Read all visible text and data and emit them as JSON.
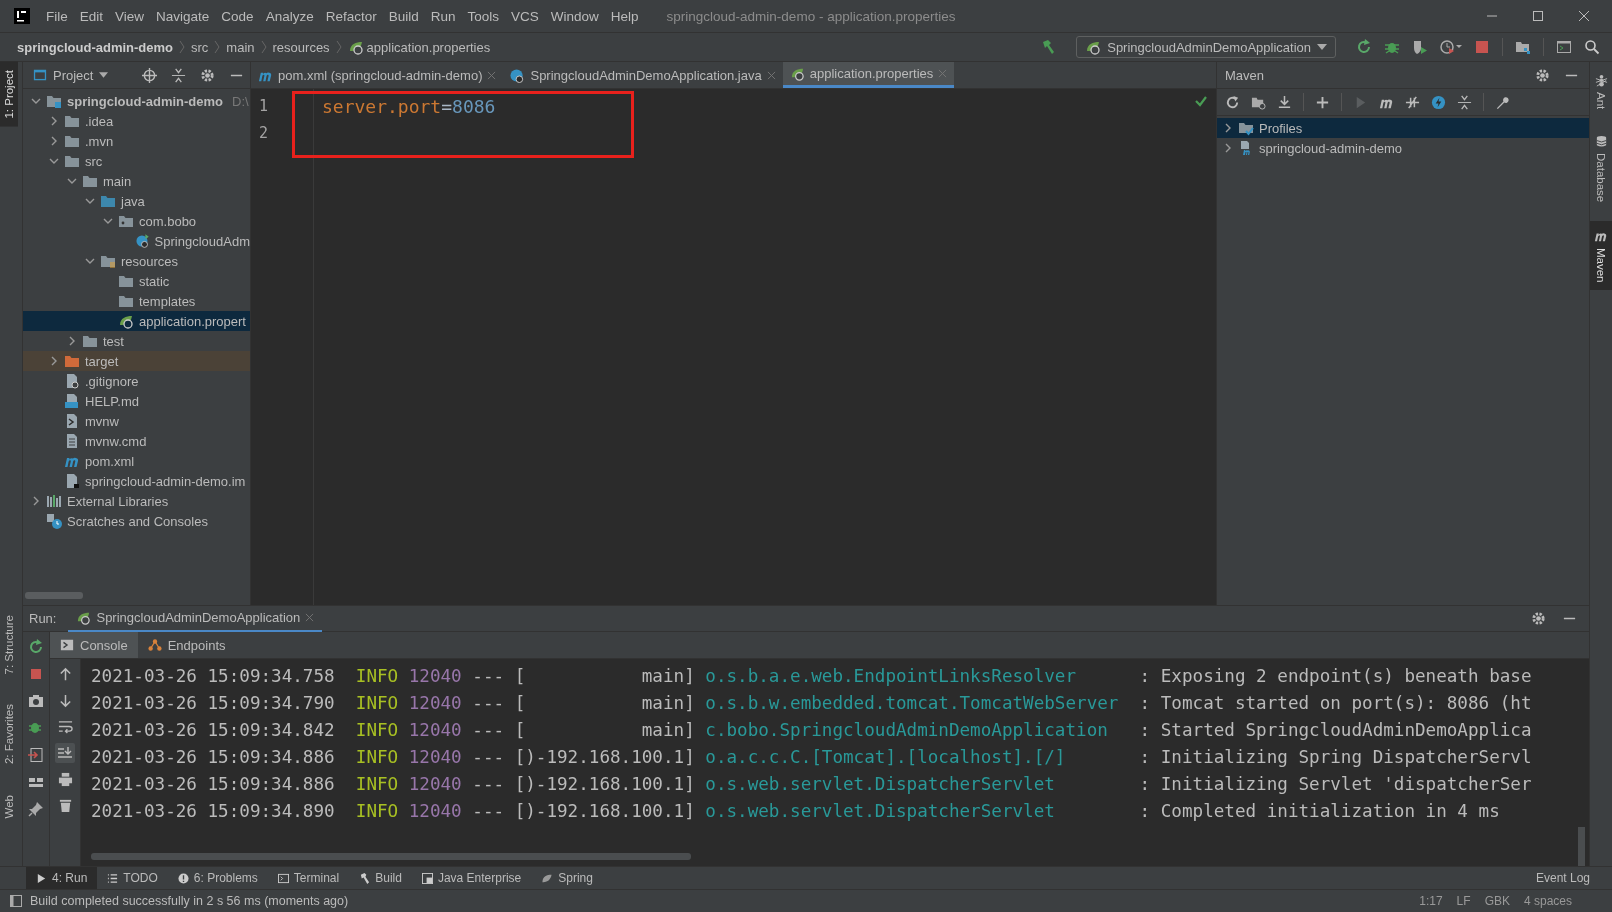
{
  "title_bar": {
    "menu": [
      "File",
      "Edit",
      "View",
      "Navigate",
      "Code",
      "Analyze",
      "Refactor",
      "Build",
      "Run",
      "Tools",
      "VCS",
      "Window",
      "Help"
    ],
    "title": "springcloud-admin-demo - application.properties"
  },
  "navigation_bar": {
    "breadcrumbs": [
      {
        "label": "springcloud-admin-demo",
        "kind": "project"
      },
      {
        "label": "src",
        "kind": "folder"
      },
      {
        "label": "main",
        "kind": "folder"
      },
      {
        "label": "resources",
        "kind": "folder"
      },
      {
        "label": "application.properties",
        "kind": "properties"
      }
    ],
    "run_configuration": "SpringcloudAdminDemoApplication"
  },
  "left_stripe": {
    "top": [
      {
        "label": "1: Project",
        "selected": true
      }
    ],
    "bottom": [
      {
        "label": "7: Structure",
        "selected": false
      },
      {
        "label": "2: Favorites",
        "selected": false
      },
      {
        "label": "Web",
        "selected": false
      }
    ]
  },
  "project": {
    "title": "Project",
    "tree": [
      {
        "label": "springcloud-admin-demo",
        "path": "D:\\",
        "kind": "module",
        "expanded": true,
        "selected": false,
        "children": [
          {
            "label": ".idea",
            "kind": "folder",
            "expanded": false,
            "selected": false
          },
          {
            "label": ".mvn",
            "kind": "folder",
            "expanded": false,
            "selected": false
          },
          {
            "label": "src",
            "kind": "folder",
            "expanded": true,
            "selected": false,
            "children": [
              {
                "label": "main",
                "kind": "folder",
                "expanded": true,
                "selected": false,
                "children": [
                  {
                    "label": "java",
                    "kind": "source-folder",
                    "expanded": true,
                    "selected": false,
                    "children": [
                      {
                        "label": "com.bobo",
                        "kind": "package",
                        "expanded": true,
                        "selected": false,
                        "children": [
                          {
                            "label": "SpringcloudAdm",
                            "kind": "spring-class",
                            "selected": false
                          }
                        ]
                      }
                    ]
                  },
                  {
                    "label": "resources",
                    "kind": "resources-folder",
                    "expanded": true,
                    "selected": false,
                    "children": [
                      {
                        "label": "static",
                        "kind": "folder",
                        "selected": false
                      },
                      {
                        "label": "templates",
                        "kind": "folder",
                        "selected": false
                      },
                      {
                        "label": "application.propert",
                        "kind": "properties",
                        "selected": true
                      }
                    ]
                  }
                ]
              },
              {
                "label": "test",
                "kind": "folder",
                "expanded": false,
                "selected": false
              }
            ]
          },
          {
            "label": "target",
            "kind": "excluded-folder",
            "expanded": false,
            "selected": false
          },
          {
            "label": ".gitignore",
            "kind": "ignore-file",
            "selected": false
          },
          {
            "label": "HELP.md",
            "kind": "markdown",
            "selected": false
          },
          {
            "label": "mvnw",
            "kind": "shell",
            "selected": false
          },
          {
            "label": "mvnw.cmd",
            "kind": "text",
            "selected": false
          },
          {
            "label": "pom.xml",
            "kind": "maven",
            "selected": false
          },
          {
            "label": "springcloud-admin-demo.im",
            "kind": "iml",
            "selected": false
          }
        ]
      },
      {
        "label": "External Libraries",
        "kind": "libraries",
        "expanded": false,
        "selected": false
      },
      {
        "label": "Scratches and Consoles",
        "kind": "scratches",
        "selected": false
      }
    ]
  },
  "editor": {
    "tabs": [
      {
        "label": "pom.xml (springcloud-admin-demo)",
        "kind": "maven",
        "selected": false
      },
      {
        "label": "SpringcloudAdminDemoApplication.java",
        "kind": "spring-class",
        "selected": false
      },
      {
        "label": "application.properties",
        "kind": "properties",
        "selected": true
      }
    ],
    "lines": [
      {
        "number": "1",
        "key": "server.port",
        "operator": "=",
        "value": "8086"
      },
      {
        "number": "2"
      }
    ]
  },
  "maven": {
    "title": "Maven",
    "tree": [
      {
        "label": "Profiles",
        "kind": "profiles",
        "selected": true
      },
      {
        "label": "springcloud-admin-demo",
        "kind": "module",
        "selected": false
      }
    ]
  },
  "right_stripe": [
    {
      "label": "Ant",
      "kind": "ant",
      "selected": false
    },
    {
      "label": "Database",
      "kind": "database",
      "selected": false
    },
    {
      "label": "Maven",
      "kind": "maven",
      "selected": true
    }
  ],
  "run": {
    "label": "Run:",
    "tab": {
      "label": "SpringcloudAdminDemoApplication",
      "selected": true
    },
    "subtabs": [
      {
        "label": "Console",
        "kind": "console",
        "selected": true
      },
      {
        "label": "Endpoints",
        "kind": "endpoints",
        "selected": false
      }
    ],
    "console": [
      {
        "timestamp": "2021-03-26 15:09:34.758",
        "level": "INFO",
        "pid": "12040",
        "separator": "---",
        "thread": "[           main]",
        "logger": "o.s.b.a.e.web.EndpointLinksResolver",
        "message": ": Exposing 2 endpoint(s) beneath base"
      },
      {
        "timestamp": "2021-03-26 15:09:34.790",
        "level": "INFO",
        "pid": "12040",
        "separator": "---",
        "thread": "[           main]",
        "logger": "o.s.b.w.embedded.tomcat.TomcatWebServer",
        "message": ": Tomcat started on port(s): 8086 (ht"
      },
      {
        "timestamp": "2021-03-26 15:09:34.842",
        "level": "INFO",
        "pid": "12040",
        "separator": "---",
        "thread": "[           main]",
        "logger": "c.bobo.SpringcloudAdminDemoApplication",
        "message": ": Started SpringcloudAdminDemoApplica"
      },
      {
        "timestamp": "2021-03-26 15:09:34.886",
        "level": "INFO",
        "pid": "12040",
        "separator": "---",
        "thread": "[)-192.168.100.1]",
        "logger": "o.a.c.c.C.[Tomcat].[localhost].[/]",
        "message": ": Initializing Spring DispatcherServl"
      },
      {
        "timestamp": "2021-03-26 15:09:34.886",
        "level": "INFO",
        "pid": "12040",
        "separator": "---",
        "thread": "[)-192.168.100.1]",
        "logger": "o.s.web.servlet.DispatcherServlet",
        "message": ": Initializing Servlet 'dispatcherSer"
      },
      {
        "timestamp": "2021-03-26 15:09:34.890",
        "level": "INFO",
        "pid": "12040",
        "separator": "---",
        "thread": "[)-192.168.100.1]",
        "logger": "o.s.web.servlet.DispatcherServlet",
        "message": ": Completed initialization in 4 ms"
      }
    ]
  },
  "tool_windows": [
    {
      "label": "4: Run",
      "kind": "run",
      "selected": true
    },
    {
      "label": "TODO",
      "kind": "todo",
      "selected": false
    },
    {
      "label": "6: Problems",
      "kind": "problems",
      "selected": false
    },
    {
      "label": "Terminal",
      "kind": "terminal",
      "selected": false
    },
    {
      "label": "Build",
      "kind": "build",
      "selected": false
    },
    {
      "label": "Java Enterprise",
      "kind": "enterprise",
      "selected": false
    },
    {
      "label": "Spring",
      "kind": "spring",
      "selected": false
    }
  ],
  "status_bar": {
    "message": "Build completed successfully in 2 s 56 ms (moments ago)",
    "event_log": "Event Log",
    "position": "1:17",
    "line_separator": "LF",
    "encoding": "GBK",
    "indent": "4 spaces"
  }
}
